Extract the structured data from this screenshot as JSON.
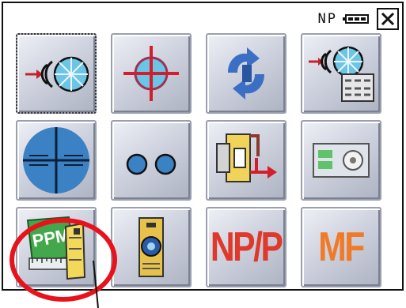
{
  "status_bar": {
    "mode_label": "NP",
    "battery_icon": "battery-icon",
    "close_icon": "close-icon"
  },
  "tiles": [
    {
      "icon": "edm-target-signal-icon"
    },
    {
      "icon": "crosshair-target-icon"
    },
    {
      "icon": "rotation-arrows-icon"
    },
    {
      "icon": "edm-target-keypad-icon"
    },
    {
      "icon": "telescope-reticle-icon"
    },
    {
      "icon": "two-dots-icon"
    },
    {
      "icon": "plug-connection-icon"
    },
    {
      "icon": "card-disc-icon"
    },
    {
      "icon": "ppm-atmospheric-correction-icon"
    },
    {
      "icon": "prism-target-icon"
    },
    {
      "label": "NP/P"
    },
    {
      "label": "MF"
    }
  ],
  "annotation": {
    "highlight_color": "#e8121c",
    "highlighted_tile": "ppm-atmospheric-correction-icon"
  },
  "colors": {
    "accent_blue": "#3b82c4",
    "alert_red": "#e8121c",
    "mf_orange": "#f07a28"
  }
}
